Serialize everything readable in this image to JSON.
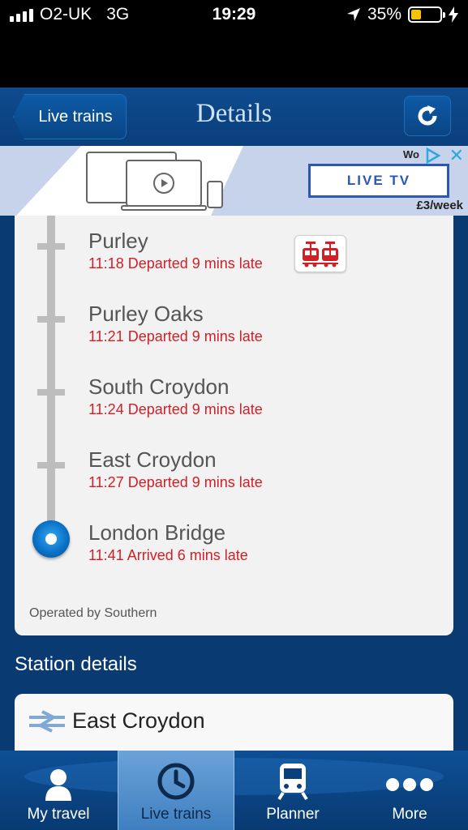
{
  "status_bar": {
    "carrier": "O2-UK",
    "network": "3G",
    "time": "19:29",
    "battery": "35%",
    "battery_level": 0.35
  },
  "header": {
    "back_label": "Live trains",
    "title": "Details",
    "refresh_icon": "refresh-icon"
  },
  "ad": {
    "cta": "LIVE TV",
    "price": "£3/week",
    "brand_partial": "Wo"
  },
  "stops": [
    {
      "name": "Purley",
      "status": "11:18 Departed 9 mins late"
    },
    {
      "name": "Purley Oaks",
      "status": "11:21 Departed 9 mins late"
    },
    {
      "name": "South Croydon",
      "status": "11:24 Departed 9 mins late"
    },
    {
      "name": "East Croydon",
      "status": "11:27 Departed 9 mins late"
    },
    {
      "name": "London Bridge",
      "status": "11:41 Arrived 6 mins late"
    }
  ],
  "operator": "Operated by Southern",
  "station_details": {
    "heading": "Station details",
    "station_name": "East Croydon"
  },
  "tabs": [
    {
      "label": "My travel",
      "icon": "person-icon"
    },
    {
      "label": "Live trains",
      "icon": "clock-icon"
    },
    {
      "label": "Planner",
      "icon": "train-icon"
    },
    {
      "label": "More",
      "icon": "more-icon"
    }
  ],
  "colors": {
    "accent": "#0a3f7c",
    "late_red": "#d21f26"
  }
}
